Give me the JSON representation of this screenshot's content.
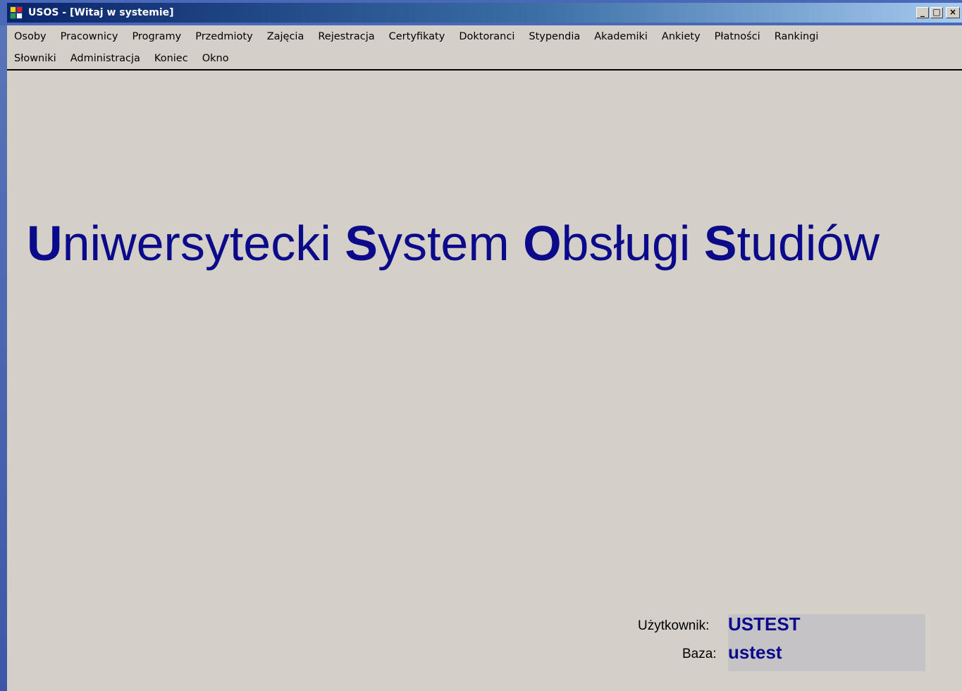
{
  "window": {
    "title": "USOS - [Witaj w systemie]",
    "controls": {
      "minimize": "_",
      "restore": "□",
      "close": "×"
    }
  },
  "menu": {
    "row1": [
      "Osoby",
      "Pracownicy",
      "Programy",
      "Przedmioty",
      "Zajęcia",
      "Rejestracja",
      "Certyfikaty",
      "Doktoranci",
      "Stypendia",
      "Akademiki",
      "Ankiety",
      "Płatności",
      "Rankingi"
    ],
    "row2": [
      "Słowniki",
      "Administracja",
      "Koniec",
      "Okno"
    ]
  },
  "headline": [
    {
      "cap": "U",
      "rest": "niwersytecki"
    },
    {
      "cap": "S",
      "rest": "ystem"
    },
    {
      "cap": "O",
      "rest": "bsługi"
    },
    {
      "cap": "S",
      "rest": "tudiów"
    }
  ],
  "info": {
    "user_label": "Użytkownik:",
    "user_value": "USTEST",
    "db_label": "Baza:",
    "db_value": "ustest"
  },
  "colors": {
    "titlebar_start": "#0a246a",
    "titlebar_end": "#a6caf0",
    "headline": "#0a0a8a",
    "background": "#d4d0c8",
    "info_panel": "#c6c3c6"
  },
  "icons": {
    "app": "usos-app-icon"
  }
}
